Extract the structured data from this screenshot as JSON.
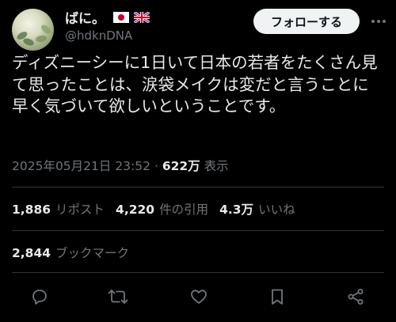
{
  "tweet": {
    "author": {
      "display_name": "ばに。",
      "handle": "@hdknDNA"
    },
    "follow_label": "フォローする",
    "text": "ディズニーシーに1日いて日本の若者をたくさん見て思ったことは、涙袋メイクは変だと言うことに早く気づいて欲しいということです。",
    "timestamp": "2025年05月21日 23:52",
    "separator": "·",
    "views_count": "622万",
    "views_label": "表示",
    "stats": {
      "reposts_count": "1,886",
      "reposts_label": "リポスト",
      "quotes_count": "4,220",
      "quotes_label": "件の引用",
      "likes_count": "4.3万",
      "likes_label": "いいね",
      "bookmarks_count": "2,844",
      "bookmarks_label": "ブックマーク"
    },
    "actions": [
      "reply-icon",
      "retweet-icon",
      "like-icon",
      "bookmark-icon",
      "share-icon"
    ]
  },
  "colors": {
    "background": "#000000",
    "text_primary": "#e7e9ea",
    "text_secondary": "#71767b",
    "divider": "#2f3336",
    "follow_button_bg": "#eff3f4",
    "follow_button_text": "#0f1419"
  }
}
